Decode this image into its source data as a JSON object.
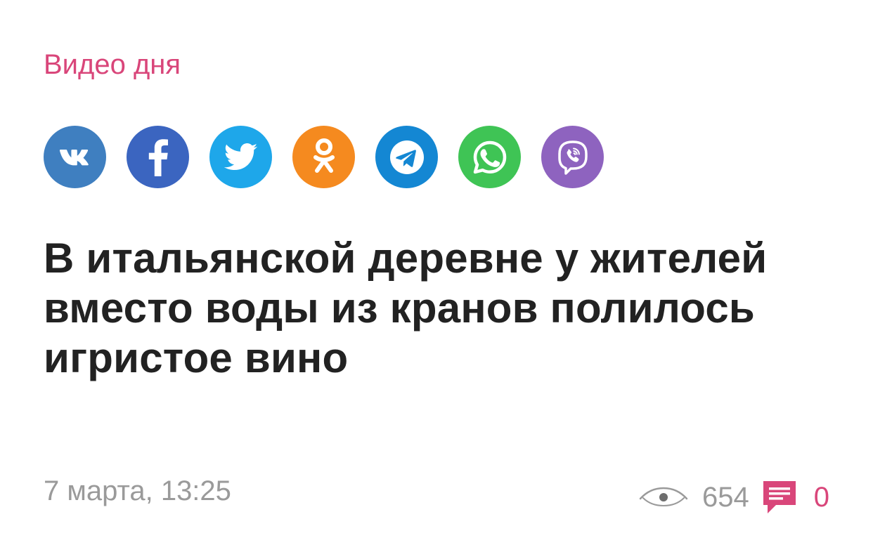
{
  "section": {
    "label": "Видео дня",
    "color": "#d9467a"
  },
  "share": {
    "buttons": [
      {
        "name": "share-vk-button",
        "icon": "vk-icon",
        "color": "#3f7fc0"
      },
      {
        "name": "share-facebook-button",
        "icon": "facebook-icon",
        "color": "#3b65c0"
      },
      {
        "name": "share-twitter-button",
        "icon": "twitter-icon",
        "color": "#1ea7ea"
      },
      {
        "name": "share-odnoklassniki-button",
        "icon": "odnoklassniki-icon",
        "color": "#f58a1f"
      },
      {
        "name": "share-telegram-button",
        "icon": "telegram-icon",
        "color": "#1487d3"
      },
      {
        "name": "share-whatsapp-button",
        "icon": "whatsapp-icon",
        "color": "#3fc455"
      },
      {
        "name": "share-viber-button",
        "icon": "viber-icon",
        "color": "#8e63bf"
      }
    ]
  },
  "article": {
    "headline": "В итальянской деревне у жителей вместо воды из кранов полилось игристое вино",
    "date": "7 марта, 13:25",
    "views": "654",
    "comments": "0",
    "views_icon": "eye-icon",
    "comments_icon": "comment-icon"
  }
}
